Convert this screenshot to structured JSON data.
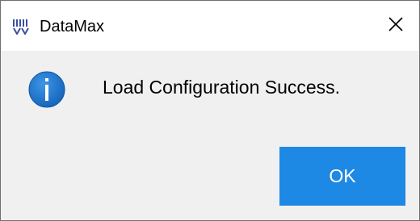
{
  "window": {
    "title": "DataMax",
    "app_icon": "barcode-scanner-icon",
    "close_icon": "close-icon"
  },
  "dialog": {
    "icon": "info-icon",
    "message": "Load Configuration Success.",
    "ok_label": "OK"
  },
  "colors": {
    "button_bg": "#1e88e5",
    "info_icon_bg": "#1a6fc9",
    "content_bg": "#f0f0f0"
  }
}
